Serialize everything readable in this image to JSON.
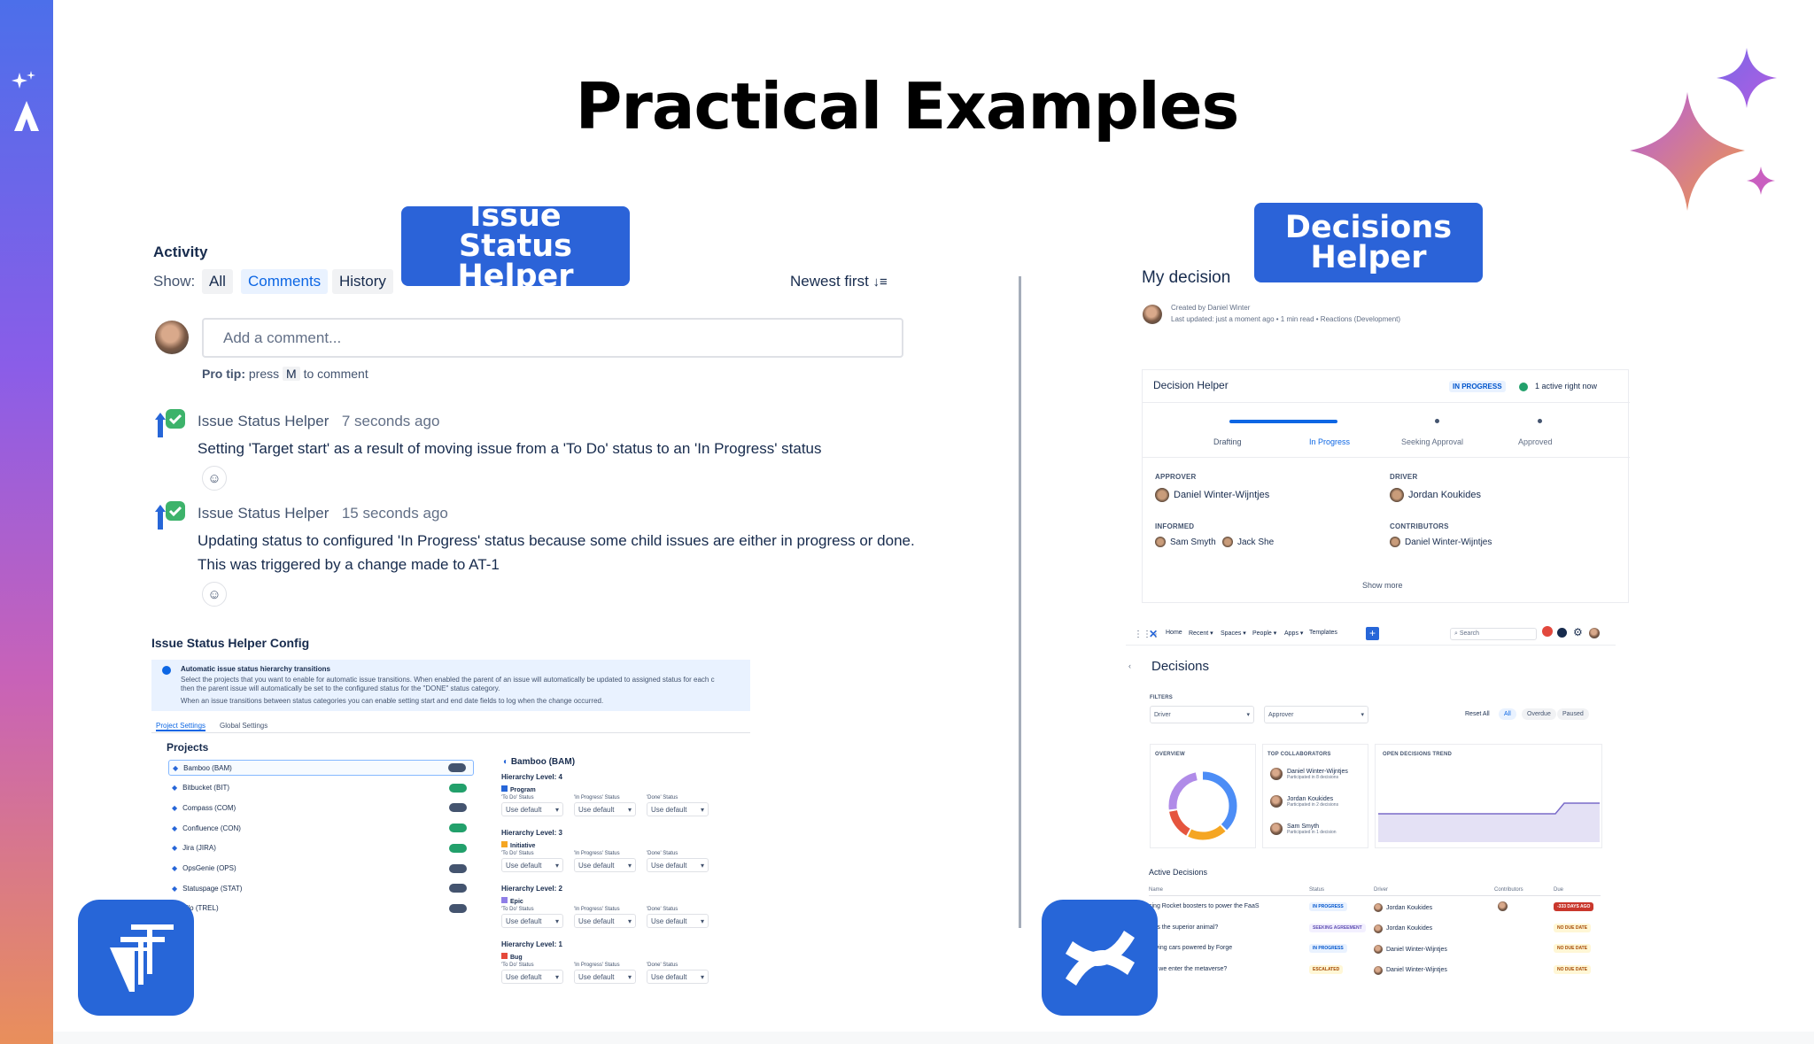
{
  "slide": {
    "title": "Practical Examples",
    "badge_left": "Issue Status Helper",
    "badge_right": "Decisions Helper"
  },
  "activity": {
    "title": "Activity",
    "show_label": "Show:",
    "filters": [
      "All",
      "Comments",
      "History"
    ],
    "sort_label": "Newest first",
    "comment_placeholder": "Add a comment...",
    "pro_tip_prefix": "Pro tip:",
    "pro_tip_press": "press",
    "pro_tip_key": "M",
    "pro_tip_suffix": "to comment",
    "entries": [
      {
        "author": "Issue Status Helper",
        "time": "7 seconds ago",
        "text": "Setting 'Target start' as a result of moving issue from a 'To Do' status to an 'In Progress' status"
      },
      {
        "author": "Issue Status Helper",
        "time": "15 seconds ago",
        "text": "Updating status to configured 'In Progress' status because some child issues are either in progress or done.",
        "text2": "This was triggered by a change made to AT-1"
      }
    ]
  },
  "config": {
    "title": "Issue Status Helper Config",
    "info_title": "Automatic issue status hierarchy transitions",
    "info_line1": "Select the projects that you want to enable for automatic issue transitions. When enabled the parent of an issue will automatically be updated to assigned status for each c",
    "info_line2": "then the parent issue will automatically be set to the configured status for the \"DONE\" status category.",
    "info_line3": "When an issue transitions between status categories you can enable setting start and end date fields to log when the change occurred.",
    "tabs": [
      "Project Settings",
      "Global Settings"
    ],
    "projects_heading": "Projects",
    "projects": [
      {
        "name": "Bamboo (BAM)",
        "on": false
      },
      {
        "name": "Bitbucket (BIT)",
        "on": true
      },
      {
        "name": "Compass (COM)",
        "on": false
      },
      {
        "name": "Confluence (CON)",
        "on": true
      },
      {
        "name": "Jira (JIRA)",
        "on": true
      },
      {
        "name": "OpsGenie (OPS)",
        "on": false
      },
      {
        "name": "Statuspage (STAT)",
        "on": false
      },
      {
        "name": "ello (TREL)",
        "on": false
      }
    ],
    "detail_title": "Bamboo (BAM)",
    "levels": [
      {
        "label": "Hierarchy Level: 4",
        "type": "Program"
      },
      {
        "label": "Hierarchy Level: 3",
        "type": "Initiative"
      },
      {
        "label": "Hierarchy Level: 2",
        "type": "Epic"
      },
      {
        "label": "Hierarchy Level: 1",
        "type": "Bug"
      }
    ],
    "col_headers": [
      "'To Do' Status",
      "'In Progress' Status",
      "'Done' Status"
    ],
    "select_value": "Use default"
  },
  "decision_page": {
    "title": "My decision",
    "created_by": "Created by Daniel Winter",
    "last_updated": "Last updated: just a moment ago • 1 min read • Reactions (Development)"
  },
  "decision_helper": {
    "title": "Decision Helper",
    "status": "IN PROGRESS",
    "active": "1 active right now",
    "steps": [
      "Drafting",
      "In Progress",
      "Seeking Approval",
      "Approved"
    ],
    "approver_label": "APPROVER",
    "approver": "Daniel Winter-Wijntjes",
    "driver_label": "DRIVER",
    "driver": "Jordan Koukides",
    "informed_label": "INFORMED",
    "informed": [
      "Sam Smyth",
      "Jack She"
    ],
    "contributors_label": "CONTRIBUTORS",
    "contributors": [
      "Daniel Winter-Wijntjes"
    ],
    "show_more": "Show more"
  },
  "decisions_app": {
    "nav": [
      "Home",
      "Recent",
      "Spaces",
      "People",
      "Apps",
      "Templates"
    ],
    "search": "Search",
    "title": "Decisions",
    "filters_label": "FILTERS",
    "filter_driver": "Driver",
    "filter_approver": "Approver",
    "reset": "Reset All",
    "status_tabs": [
      "All",
      "Overdue",
      "Paused"
    ],
    "overview_label": "OVERVIEW",
    "collab_label": "TOP COLLABORATORS",
    "trend_label": "OPEN DECISIONS TREND",
    "collaborators": [
      {
        "name": "Daniel Winter-Wijntjes",
        "sub": "Participated in 8 decisions"
      },
      {
        "name": "Jordan Koukides",
        "sub": "Participated in 2 decisions"
      },
      {
        "name": "Sam Smyth",
        "sub": "Participated in 1 decision"
      }
    ],
    "active_label": "Active Decisions",
    "table_headers": [
      "Name",
      "Status",
      "Driver",
      "Contributors",
      "Due"
    ],
    "rows": [
      {
        "name": "sing Rocket boosters to power the FaaS",
        "status": "IN PROGRESS",
        "driver": "Jordan Koukides",
        "due": "-333 DAYS AGO"
      },
      {
        "name": "cats the superior animal?",
        "status": "SEEKING AGREEMENT",
        "driver": "Jordan Koukides",
        "due": "NO DUE DATE"
      },
      {
        "name": "driving cars powered by Forge",
        "status": "IN PROGRESS",
        "driver": "Daniel Winter-Wijntjes",
        "due": "NO DUE DATE"
      },
      {
        "name": "uld we enter the metaverse?",
        "status": "ESCALATED",
        "driver": "Daniel Winter-Wijntjes",
        "due": "NO DUE DATE"
      }
    ]
  }
}
